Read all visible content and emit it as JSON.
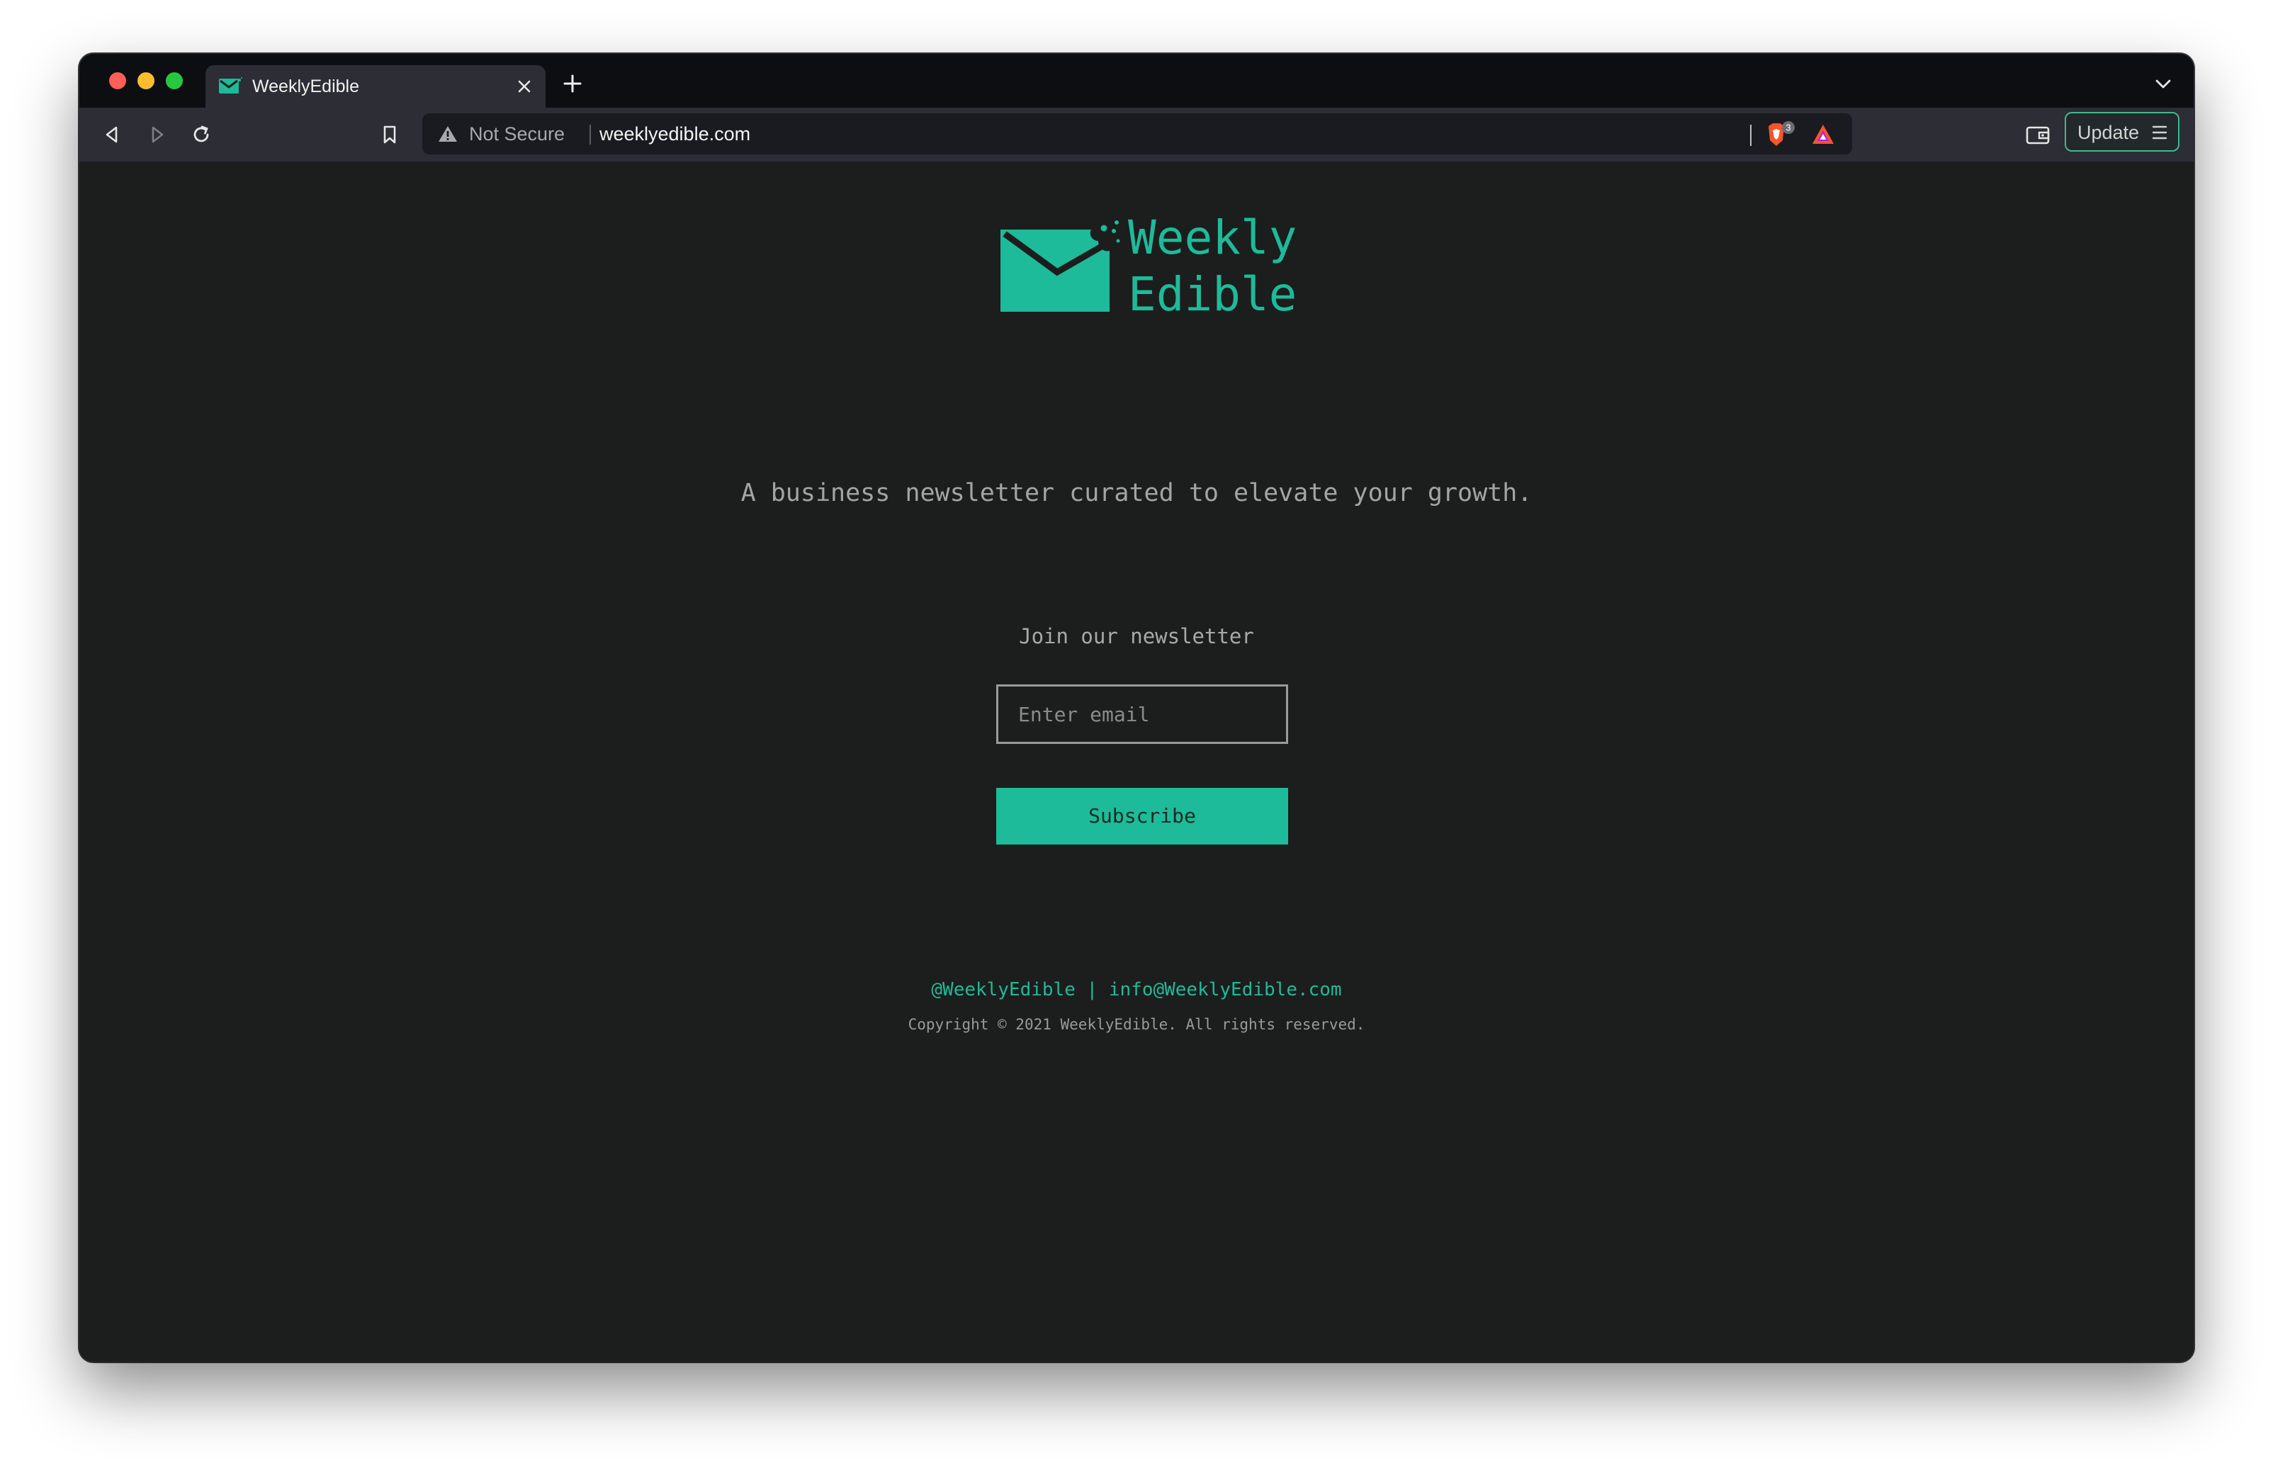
{
  "browser": {
    "tab": {
      "title": "WeeklyEdible",
      "favicon": "envelope-icon"
    },
    "toolbar": {
      "security_label": "Not Secure",
      "url": "weeklyedible.com",
      "shield_count": "3",
      "update_label": "Update"
    },
    "colors": {
      "tabstrip": "#0d0e12",
      "toolbar": "#2c2d35",
      "traffic_red": "#fe5f57",
      "traffic_yellow": "#febc2e",
      "traffic_green": "#27c840"
    }
  },
  "page": {
    "logo": {
      "line1": "Weekly",
      "line2": "Edible",
      "icon": "bitten-envelope-icon"
    },
    "tagline": "A business newsletter curated to elevate your growth.",
    "newsletter": {
      "label": "Join our newsletter",
      "email_placeholder": "Enter email",
      "email_value": "",
      "subscribe_label": "Subscribe"
    },
    "footer": {
      "twitter_handle": "@WeeklyEdible",
      "separator": "|",
      "email": "info@WeeklyEdible.com",
      "copyright": "Copyright © 2021 WeeklyEdible. All rights reserved."
    },
    "colors": {
      "accent": "#1dbb99",
      "background": "#1c1d1d",
      "muted_text": "#a4a4a4"
    }
  }
}
